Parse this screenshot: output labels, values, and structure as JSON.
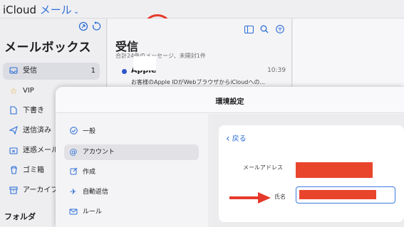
{
  "app": {
    "name": "iCloud",
    "section": "メール",
    "chevron": "⌄"
  },
  "sidebar": {
    "heading": "メールボックス",
    "tools": [
      "compose-icon",
      "refresh-icon"
    ],
    "items": [
      {
        "label": "受信",
        "icon": "inbox-icon",
        "count": "1",
        "active": true
      },
      {
        "label": "VIP",
        "icon": "star-icon"
      },
      {
        "label": "下書き",
        "icon": "document-icon"
      },
      {
        "label": "送信済み",
        "icon": "paperplane-icon"
      },
      {
        "label": "迷惑メール",
        "icon": "junk-icon"
      },
      {
        "label": "ゴミ箱",
        "icon": "trash-icon"
      },
      {
        "label": "アーカイブ",
        "icon": "archive-icon"
      }
    ],
    "folders_heading": "フォルダ"
  },
  "list": {
    "title": "受信",
    "subtitle": "合計24件のメッセージ、未開封1件",
    "message": {
      "sender": "Apple",
      "time": "10:39",
      "preview": "お客様のApple IDがWebブラウザからiCloudへの..."
    }
  },
  "settings": {
    "title": "環境設定",
    "nav": [
      {
        "label": "一般",
        "icon": "checkmark-circle-icon"
      },
      {
        "label": "アカウント",
        "icon": "at-icon",
        "active": true
      },
      {
        "label": "作成",
        "icon": "edit-icon"
      },
      {
        "label": "自動返信",
        "icon": "airplane-icon"
      },
      {
        "label": "ルール",
        "icon": "rules-icon"
      }
    ],
    "back": "戻る",
    "email_label": "メールアドレス",
    "name_label": "氏名"
  },
  "colors": {
    "accent": "#2f6fd6",
    "annotation": "#e53a2b",
    "redaction": "#e8452c"
  }
}
